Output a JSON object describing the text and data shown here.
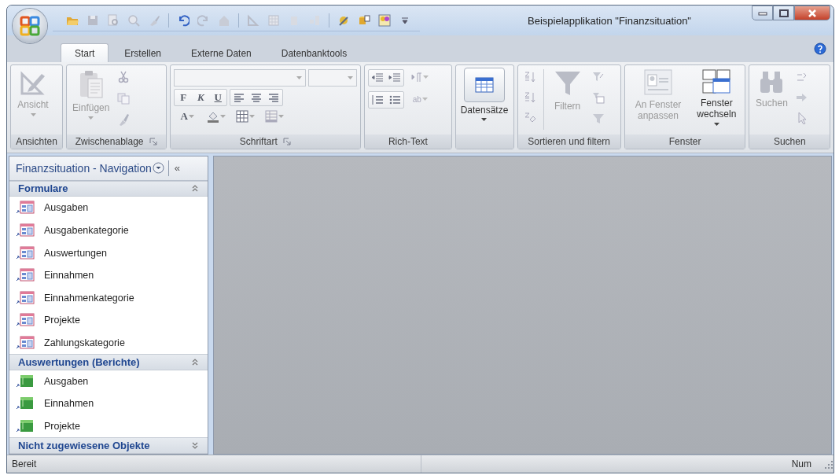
{
  "window": {
    "title": "Beispielapplikation \"Finanzsituation\""
  },
  "tabs": [
    {
      "label": "Start",
      "selected": true
    },
    {
      "label": "Erstellen",
      "selected": false
    },
    {
      "label": "Externe Daten",
      "selected": false
    },
    {
      "label": "Datenbanktools",
      "selected": false
    }
  ],
  "ribbon": {
    "groups": [
      {
        "label": "Ansichten",
        "launcher": false,
        "controls": [
          {
            "kind": "large",
            "label": "Ansicht",
            "disabled": true,
            "dropdown": true
          }
        ]
      },
      {
        "label": "Zwischenablage",
        "launcher": true,
        "controls": [
          {
            "kind": "large",
            "label": "Einfügen",
            "disabled": true,
            "dropdown": true
          },
          {
            "kind": "clipboardtools"
          }
        ]
      },
      {
        "label": "Schriftart",
        "launcher": true,
        "controls": [
          {
            "kind": "fontpanel",
            "style_buttons": [
              "F",
              "K",
              "U"
            ],
            "color_button": "A"
          }
        ]
      },
      {
        "label": "Rich-Text",
        "launcher": false,
        "controls": [
          {
            "kind": "richtext",
            "highlight_button": "ab"
          }
        ]
      },
      {
        "launcher": false,
        "controls": [
          {
            "kind": "bigbutton",
            "label": "Datensätze",
            "disabled": false,
            "dropdown": true
          }
        ]
      },
      {
        "label": "Sortieren und filtern",
        "launcher": false,
        "controls": [
          {
            "kind": "sorttools"
          },
          {
            "kind": "large",
            "label": "Filtern",
            "disabled": true,
            "dropdown": false
          },
          {
            "kind": "filtertools"
          }
        ]
      },
      {
        "label": "Fenster",
        "launcher": false,
        "controls": [
          {
            "kind": "large",
            "label": "An Fenster anpassen",
            "disabled": true,
            "dropdown": false
          },
          {
            "kind": "large",
            "label": "Fenster wechseln",
            "disabled": false,
            "dropdown": true
          }
        ]
      },
      {
        "label": "Suchen",
        "launcher": false,
        "controls": [
          {
            "kind": "large",
            "label": "Suchen",
            "disabled": true,
            "dropdown": false
          },
          {
            "kind": "findtools"
          }
        ]
      }
    ]
  },
  "navigation": {
    "title": "Finanzsituation - Navigation",
    "collapse_glyph": "«",
    "groups": [
      {
        "title": "Formulare",
        "expanded": true,
        "items": [
          {
            "label": "Ausgaben",
            "kind": "form"
          },
          {
            "label": "Ausgabenkategorie",
            "kind": "form"
          },
          {
            "label": "Auswertungen",
            "kind": "form"
          },
          {
            "label": "Einnahmen",
            "kind": "form"
          },
          {
            "label": "Einnahmenkategorie",
            "kind": "form"
          },
          {
            "label": "Projekte",
            "kind": "form"
          },
          {
            "label": "Zahlungskategorie",
            "kind": "form"
          }
        ]
      },
      {
        "title": "Auswertungen (Berichte)",
        "expanded": true,
        "items": [
          {
            "label": "Ausgaben",
            "kind": "report"
          },
          {
            "label": "Einnahmen",
            "kind": "report"
          },
          {
            "label": "Projekte",
            "kind": "report"
          }
        ]
      },
      {
        "title": "Nicht zugewiesene Objekte",
        "expanded": false
      }
    ]
  },
  "status_bar": {
    "text": "Bereit",
    "indicator": "Num"
  }
}
